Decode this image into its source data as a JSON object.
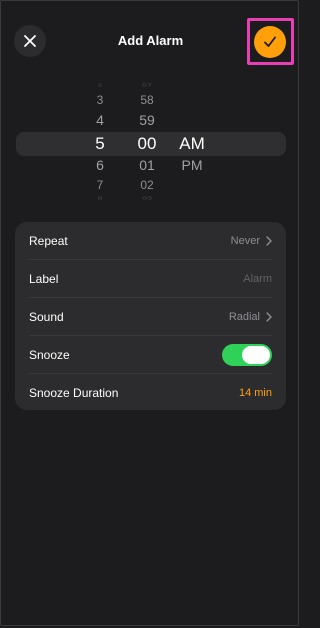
{
  "header": {
    "title": "Add Alarm",
    "close_icon": "close-icon",
    "confirm_icon": "checkmark-icon",
    "accent": "#ff9f0a"
  },
  "picker": {
    "hours": [
      "2",
      "3",
      "4",
      "5",
      "6",
      "7",
      "8"
    ],
    "minutes": [
      "57",
      "58",
      "59",
      "00",
      "01",
      "02",
      "03"
    ],
    "meridiem": [
      "AM",
      "PM"
    ],
    "selected": {
      "hour": "5",
      "minute": "00",
      "meridiem": "AM"
    }
  },
  "settings": {
    "repeat": {
      "label": "Repeat",
      "value": "Never"
    },
    "label": {
      "label": "Label",
      "placeholder": "Alarm"
    },
    "sound": {
      "label": "Sound",
      "value": "Radial"
    },
    "snooze": {
      "label": "Snooze",
      "on": true,
      "toggle_color": "#30d158"
    },
    "snooze_duration": {
      "label": "Snooze Duration",
      "value": "14 min"
    }
  }
}
